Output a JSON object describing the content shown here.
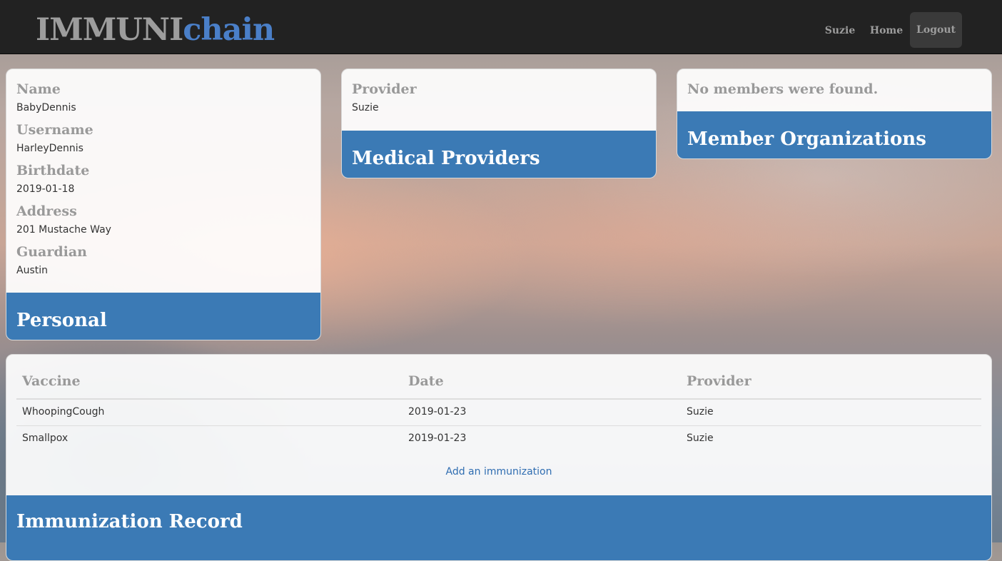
{
  "navbar": {
    "brand_part1": "IMMUNI",
    "brand_part2": "chain",
    "links": [
      "Suzie",
      "Home",
      "Logout"
    ]
  },
  "personal": {
    "title": "Personal",
    "fields": [
      {
        "label": "Name",
        "value": "BabyDennis"
      },
      {
        "label": "Username",
        "value": "HarleyDennis"
      },
      {
        "label": "Birthdate",
        "value": "2019-01-18"
      },
      {
        "label": "Address",
        "value": "201 Mustache Way"
      },
      {
        "label": "Guardian",
        "value": "Austin"
      }
    ]
  },
  "providers": {
    "title": "Medical Providers",
    "label": "Provider",
    "value": "Suzie"
  },
  "organizations": {
    "title": "Member Organizations",
    "message": "No members were found."
  },
  "immunizations": {
    "title": "Immunization Record",
    "columns": [
      "Vaccine",
      "Date",
      "Provider"
    ],
    "rows": [
      [
        "WhoopingCough",
        "2019-01-23",
        "Suzie"
      ],
      [
        "Smallpox",
        "2019-01-23",
        "Suzie"
      ]
    ],
    "add_link": "Add an immunization"
  },
  "colors": {
    "navbar": "#222222",
    "brand_accent": "#4a7fc8",
    "card_footer": "#3b7ab5",
    "link": "#2f6db1"
  }
}
